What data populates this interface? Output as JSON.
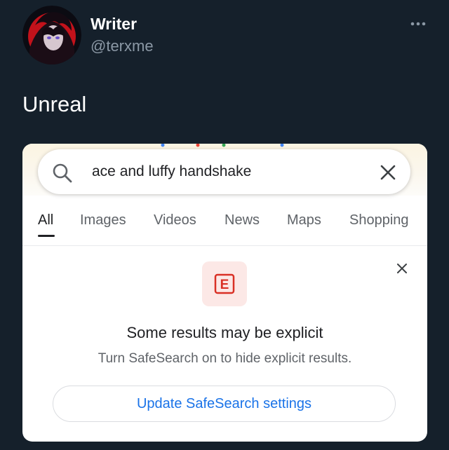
{
  "author": {
    "name": "Writer",
    "handle": "@terxme"
  },
  "tweet": {
    "text": "Unreal"
  },
  "search": {
    "query": "ace and luffy handshake"
  },
  "tabs": [
    {
      "label": "All",
      "active": true
    },
    {
      "label": "Images",
      "active": false
    },
    {
      "label": "Videos",
      "active": false
    },
    {
      "label": "News",
      "active": false
    },
    {
      "label": "Maps",
      "active": false
    },
    {
      "label": "Shopping",
      "active": false
    }
  ],
  "safesearch": {
    "title": "Some results may be explicit",
    "subtitle": "Turn SafeSearch on to hide explicit results.",
    "button_label": "Update SafeSearch settings",
    "badge_letter": "E"
  },
  "colors": {
    "background": "#15202b",
    "handle": "#8b98a5",
    "link_blue": "#1a73e8",
    "explicit_red": "#d93025",
    "badge_bg": "#fce8e6"
  },
  "icons": [
    "more-icon",
    "search-icon",
    "clear-icon",
    "close-icon",
    "explicit-icon"
  ]
}
